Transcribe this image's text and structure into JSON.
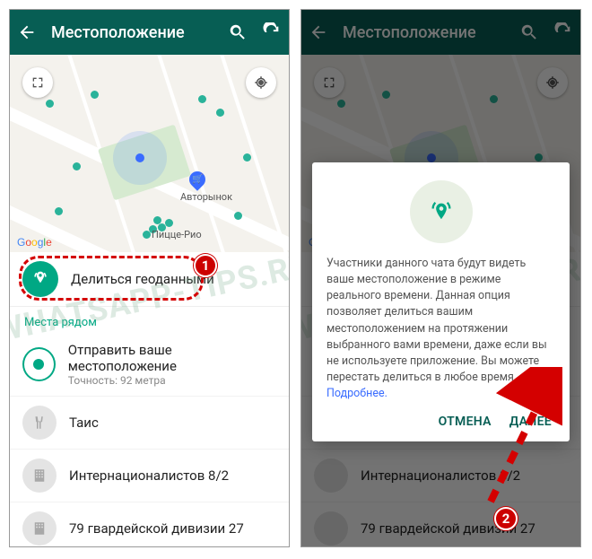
{
  "toolbar": {
    "title": "Местоположение"
  },
  "map": {
    "placeLabel1": "Авторынок",
    "placeLabel2": "Пицце-Рио",
    "attribution": "Google"
  },
  "share": {
    "label": "Делиться геоданными"
  },
  "section": {
    "nearby": "Места рядом"
  },
  "sendLocation": {
    "title": "Отправить ваше местоположение",
    "sub": "Точность: 92 метра"
  },
  "places": [
    {
      "title": "Таис"
    },
    {
      "title": "Интернационалистов 8/2"
    },
    {
      "title": "79 гвардейской дивизии 27"
    }
  ],
  "dialog": {
    "body": "Участники данного чата будут видеть ваше местоположение в режиме реального времени. Данная опция позволяет делиться вашим местоположением на протяжении выбранного вами времени, даже если вы не используете приложение. Вы можете перестать делиться в любое время. ",
    "more": "Подробнее.",
    "cancel": "ОТМЕНА",
    "next": "ДАЛЕЕ"
  },
  "callouts": {
    "badge1": "1",
    "badge2": "2"
  },
  "watermark": "WHATSAPP-TIPS.RU"
}
